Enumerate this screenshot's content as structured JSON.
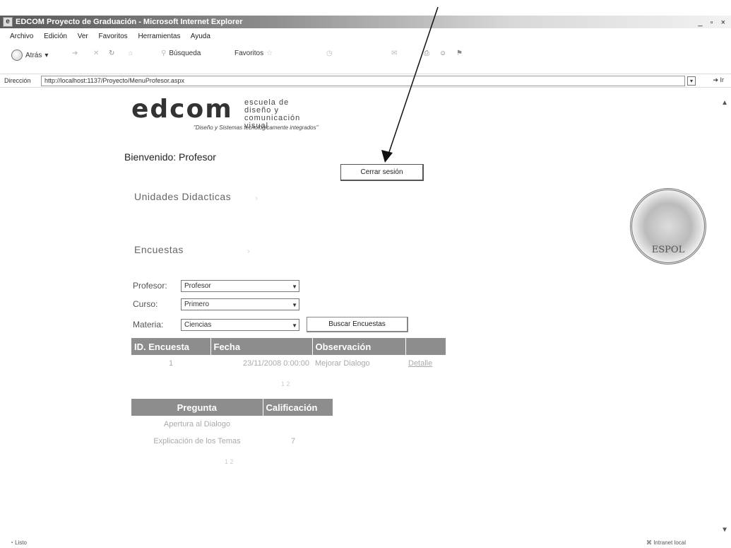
{
  "window": {
    "title": "EDCOM Proyecto de Graduación - Microsoft Internet Explorer",
    "controls": "_ ▫ ×"
  },
  "menu": [
    "Archivo",
    "Edición",
    "Ver",
    "Favoritos",
    "Herramientas",
    "Ayuda"
  ],
  "toolbar": {
    "back_label": "Atrás",
    "search_label": "Búsqueda",
    "favorites_label": "Favoritos"
  },
  "address": {
    "label": "Dirección",
    "url": "http://localhost:1137/Proyecto/MenuProfesor.aspx",
    "go_label": "Ir"
  },
  "logo": {
    "main": "edcom",
    "side_line1": "escuela de diseño y",
    "side_line2": "comunicación visual",
    "tagline": "\"Diseño y Sistemas tecnológicamente integrados\""
  },
  "welcome": "Bienvenido: Profesor",
  "logout_label": "Cerrar sesión",
  "sections": {
    "unidades": "Unidades Didacticas",
    "encuestas": "Encuestas"
  },
  "form": {
    "profesor_label": "Profesor:",
    "profesor_value": "Profesor",
    "curso_label": "Curso:",
    "curso_value": "Primero",
    "materia_label": "Materia:",
    "materia_value": "Ciencias",
    "search_button": "Buscar Encuestas"
  },
  "encuestas_table": {
    "headers": [
      "ID. Encuesta",
      "Fecha",
      "Observación",
      ""
    ],
    "rows": [
      {
        "id": "1",
        "fecha": "23/11/2008 0:00:00",
        "observacion": "Mejorar Dialogo",
        "link": "Detalle"
      }
    ],
    "pager": "1 2"
  },
  "preguntas_table": {
    "headers": [
      "Pregunta",
      "Calificación"
    ],
    "rows": [
      {
        "pregunta": "Apertura al Dialogo",
        "calificacion": ""
      },
      {
        "pregunta": "Explicación de los Temas",
        "calificacion": "7"
      }
    ],
    "pager": "1 2"
  },
  "seal": {
    "text": "ESPOL"
  },
  "status": {
    "left": "Listo",
    "right": "Intranet local"
  }
}
